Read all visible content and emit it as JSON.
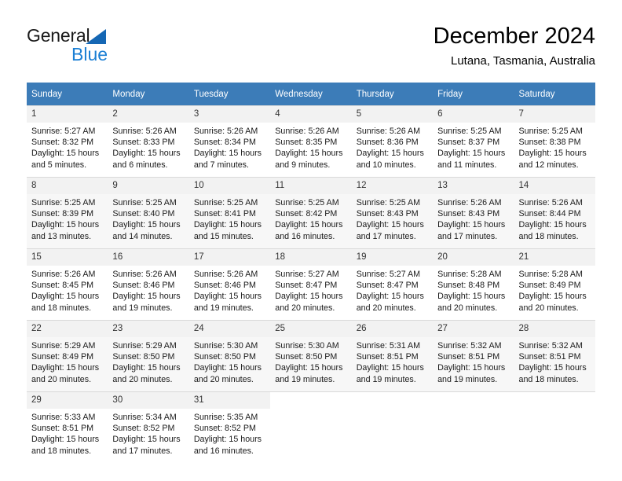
{
  "brand": {
    "name_top": "General",
    "name_bottom": "Blue",
    "triangle_color": "#1567b4",
    "blue_color": "#1b7fd4"
  },
  "header": {
    "title": "December 2024",
    "location": "Lutana, Tasmania, Australia"
  },
  "theme": {
    "header_bg": "#3c7cb8",
    "header_text": "#ffffff",
    "daynum_bg": "#f2f2f2",
    "row_shade_bg": "#f7f7f7",
    "grid_line": "#d9d9d9"
  },
  "calendar": {
    "weekday_headers": [
      "Sunday",
      "Monday",
      "Tuesday",
      "Wednesday",
      "Thursday",
      "Friday",
      "Saturday"
    ],
    "labels": {
      "sunrise": "Sunrise:",
      "sunset": "Sunset:",
      "daylight": "Daylight:"
    },
    "weeks": [
      [
        {
          "day": "1",
          "sunrise": "Sunrise: 5:27 AM",
          "sunset": "Sunset: 8:32 PM",
          "daylight_1": "Daylight: 15 hours",
          "daylight_2": "and 5 minutes."
        },
        {
          "day": "2",
          "sunrise": "Sunrise: 5:26 AM",
          "sunset": "Sunset: 8:33 PM",
          "daylight_1": "Daylight: 15 hours",
          "daylight_2": "and 6 minutes."
        },
        {
          "day": "3",
          "sunrise": "Sunrise: 5:26 AM",
          "sunset": "Sunset: 8:34 PM",
          "daylight_1": "Daylight: 15 hours",
          "daylight_2": "and 7 minutes."
        },
        {
          "day": "4",
          "sunrise": "Sunrise: 5:26 AM",
          "sunset": "Sunset: 8:35 PM",
          "daylight_1": "Daylight: 15 hours",
          "daylight_2": "and 9 minutes."
        },
        {
          "day": "5",
          "sunrise": "Sunrise: 5:26 AM",
          "sunset": "Sunset: 8:36 PM",
          "daylight_1": "Daylight: 15 hours",
          "daylight_2": "and 10 minutes."
        },
        {
          "day": "6",
          "sunrise": "Sunrise: 5:25 AM",
          "sunset": "Sunset: 8:37 PM",
          "daylight_1": "Daylight: 15 hours",
          "daylight_2": "and 11 minutes."
        },
        {
          "day": "7",
          "sunrise": "Sunrise: 5:25 AM",
          "sunset": "Sunset: 8:38 PM",
          "daylight_1": "Daylight: 15 hours",
          "daylight_2": "and 12 minutes."
        }
      ],
      [
        {
          "day": "8",
          "sunrise": "Sunrise: 5:25 AM",
          "sunset": "Sunset: 8:39 PM",
          "daylight_1": "Daylight: 15 hours",
          "daylight_2": "and 13 minutes."
        },
        {
          "day": "9",
          "sunrise": "Sunrise: 5:25 AM",
          "sunset": "Sunset: 8:40 PM",
          "daylight_1": "Daylight: 15 hours",
          "daylight_2": "and 14 minutes."
        },
        {
          "day": "10",
          "sunrise": "Sunrise: 5:25 AM",
          "sunset": "Sunset: 8:41 PM",
          "daylight_1": "Daylight: 15 hours",
          "daylight_2": "and 15 minutes."
        },
        {
          "day": "11",
          "sunrise": "Sunrise: 5:25 AM",
          "sunset": "Sunset: 8:42 PM",
          "daylight_1": "Daylight: 15 hours",
          "daylight_2": "and 16 minutes."
        },
        {
          "day": "12",
          "sunrise": "Sunrise: 5:25 AM",
          "sunset": "Sunset: 8:43 PM",
          "daylight_1": "Daylight: 15 hours",
          "daylight_2": "and 17 minutes."
        },
        {
          "day": "13",
          "sunrise": "Sunrise: 5:26 AM",
          "sunset": "Sunset: 8:43 PM",
          "daylight_1": "Daylight: 15 hours",
          "daylight_2": "and 17 minutes."
        },
        {
          "day": "14",
          "sunrise": "Sunrise: 5:26 AM",
          "sunset": "Sunset: 8:44 PM",
          "daylight_1": "Daylight: 15 hours",
          "daylight_2": "and 18 minutes."
        }
      ],
      [
        {
          "day": "15",
          "sunrise": "Sunrise: 5:26 AM",
          "sunset": "Sunset: 8:45 PM",
          "daylight_1": "Daylight: 15 hours",
          "daylight_2": "and 18 minutes."
        },
        {
          "day": "16",
          "sunrise": "Sunrise: 5:26 AM",
          "sunset": "Sunset: 8:46 PM",
          "daylight_1": "Daylight: 15 hours",
          "daylight_2": "and 19 minutes."
        },
        {
          "day": "17",
          "sunrise": "Sunrise: 5:26 AM",
          "sunset": "Sunset: 8:46 PM",
          "daylight_1": "Daylight: 15 hours",
          "daylight_2": "and 19 minutes."
        },
        {
          "day": "18",
          "sunrise": "Sunrise: 5:27 AM",
          "sunset": "Sunset: 8:47 PM",
          "daylight_1": "Daylight: 15 hours",
          "daylight_2": "and 20 minutes."
        },
        {
          "day": "19",
          "sunrise": "Sunrise: 5:27 AM",
          "sunset": "Sunset: 8:47 PM",
          "daylight_1": "Daylight: 15 hours",
          "daylight_2": "and 20 minutes."
        },
        {
          "day": "20",
          "sunrise": "Sunrise: 5:28 AM",
          "sunset": "Sunset: 8:48 PM",
          "daylight_1": "Daylight: 15 hours",
          "daylight_2": "and 20 minutes."
        },
        {
          "day": "21",
          "sunrise": "Sunrise: 5:28 AM",
          "sunset": "Sunset: 8:49 PM",
          "daylight_1": "Daylight: 15 hours",
          "daylight_2": "and 20 minutes."
        }
      ],
      [
        {
          "day": "22",
          "sunrise": "Sunrise: 5:29 AM",
          "sunset": "Sunset: 8:49 PM",
          "daylight_1": "Daylight: 15 hours",
          "daylight_2": "and 20 minutes."
        },
        {
          "day": "23",
          "sunrise": "Sunrise: 5:29 AM",
          "sunset": "Sunset: 8:50 PM",
          "daylight_1": "Daylight: 15 hours",
          "daylight_2": "and 20 minutes."
        },
        {
          "day": "24",
          "sunrise": "Sunrise: 5:30 AM",
          "sunset": "Sunset: 8:50 PM",
          "daylight_1": "Daylight: 15 hours",
          "daylight_2": "and 20 minutes."
        },
        {
          "day": "25",
          "sunrise": "Sunrise: 5:30 AM",
          "sunset": "Sunset: 8:50 PM",
          "daylight_1": "Daylight: 15 hours",
          "daylight_2": "and 19 minutes."
        },
        {
          "day": "26",
          "sunrise": "Sunrise: 5:31 AM",
          "sunset": "Sunset: 8:51 PM",
          "daylight_1": "Daylight: 15 hours",
          "daylight_2": "and 19 minutes."
        },
        {
          "day": "27",
          "sunrise": "Sunrise: 5:32 AM",
          "sunset": "Sunset: 8:51 PM",
          "daylight_1": "Daylight: 15 hours",
          "daylight_2": "and 19 minutes."
        },
        {
          "day": "28",
          "sunrise": "Sunrise: 5:32 AM",
          "sunset": "Sunset: 8:51 PM",
          "daylight_1": "Daylight: 15 hours",
          "daylight_2": "and 18 minutes."
        }
      ],
      [
        {
          "day": "29",
          "sunrise": "Sunrise: 5:33 AM",
          "sunset": "Sunset: 8:51 PM",
          "daylight_1": "Daylight: 15 hours",
          "daylight_2": "and 18 minutes."
        },
        {
          "day": "30",
          "sunrise": "Sunrise: 5:34 AM",
          "sunset": "Sunset: 8:52 PM",
          "daylight_1": "Daylight: 15 hours",
          "daylight_2": "and 17 minutes."
        },
        {
          "day": "31",
          "sunrise": "Sunrise: 5:35 AM",
          "sunset": "Sunset: 8:52 PM",
          "daylight_1": "Daylight: 15 hours",
          "daylight_2": "and 16 minutes."
        },
        {
          "day": "",
          "sunrise": "",
          "sunset": "",
          "daylight_1": "",
          "daylight_2": ""
        },
        {
          "day": "",
          "sunrise": "",
          "sunset": "",
          "daylight_1": "",
          "daylight_2": ""
        },
        {
          "day": "",
          "sunrise": "",
          "sunset": "",
          "daylight_1": "",
          "daylight_2": ""
        },
        {
          "day": "",
          "sunrise": "",
          "sunset": "",
          "daylight_1": "",
          "daylight_2": ""
        }
      ]
    ]
  }
}
